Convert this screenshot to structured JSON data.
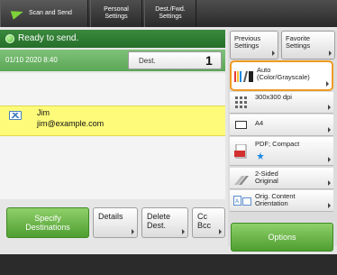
{
  "tabs": {
    "scan_and_send": "Scan and Send",
    "personal_settings": "Personal\nSettings",
    "dest_fwd_settings": "Dest./Fwd.\nSettings"
  },
  "status": {
    "message": "Ready to send.",
    "datetime": "01/10 2020 8:40",
    "dest_label": "Dest.",
    "dest_count": "1"
  },
  "destination": {
    "name": "Jim",
    "email": "jim@example.com"
  },
  "buttons": {
    "specify": "Specify\nDestinations",
    "details": "Details",
    "delete": "Delete\nDest.",
    "cc_bcc": "Cc\nBcc",
    "previous_settings": "Previous\nSettings",
    "favorite_settings": "Favorite\nSettings",
    "options": "Options"
  },
  "settings": {
    "color": "Auto\n(Color/Grayscale)",
    "resolution": "300x300 dpi",
    "size": "A4",
    "format": "PDF; Compact",
    "sided": "2-Sided\nOriginal",
    "orientation": "Orig. Content\nOrientation"
  },
  "colors": {
    "accent_green": "#4e9e30",
    "highlight_orange": "#f09a23",
    "selected_row": "#fffb7a"
  }
}
